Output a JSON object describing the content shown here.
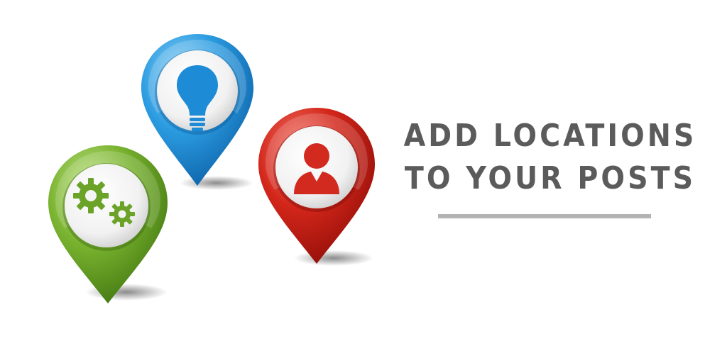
{
  "headline": {
    "line1": "ADD LOCATIONS",
    "line2": "TO YOUR POSTS"
  },
  "pins": [
    {
      "color": "#39a8e0",
      "icon": "lightbulb-icon"
    },
    {
      "color": "#d52b1e",
      "icon": "user-icon"
    },
    {
      "color": "#7ab431",
      "icon": "gears-icon"
    }
  ],
  "colors": {
    "text": "#5b5b5b",
    "divider": "#b3b3b3",
    "background": "#ffffff"
  }
}
